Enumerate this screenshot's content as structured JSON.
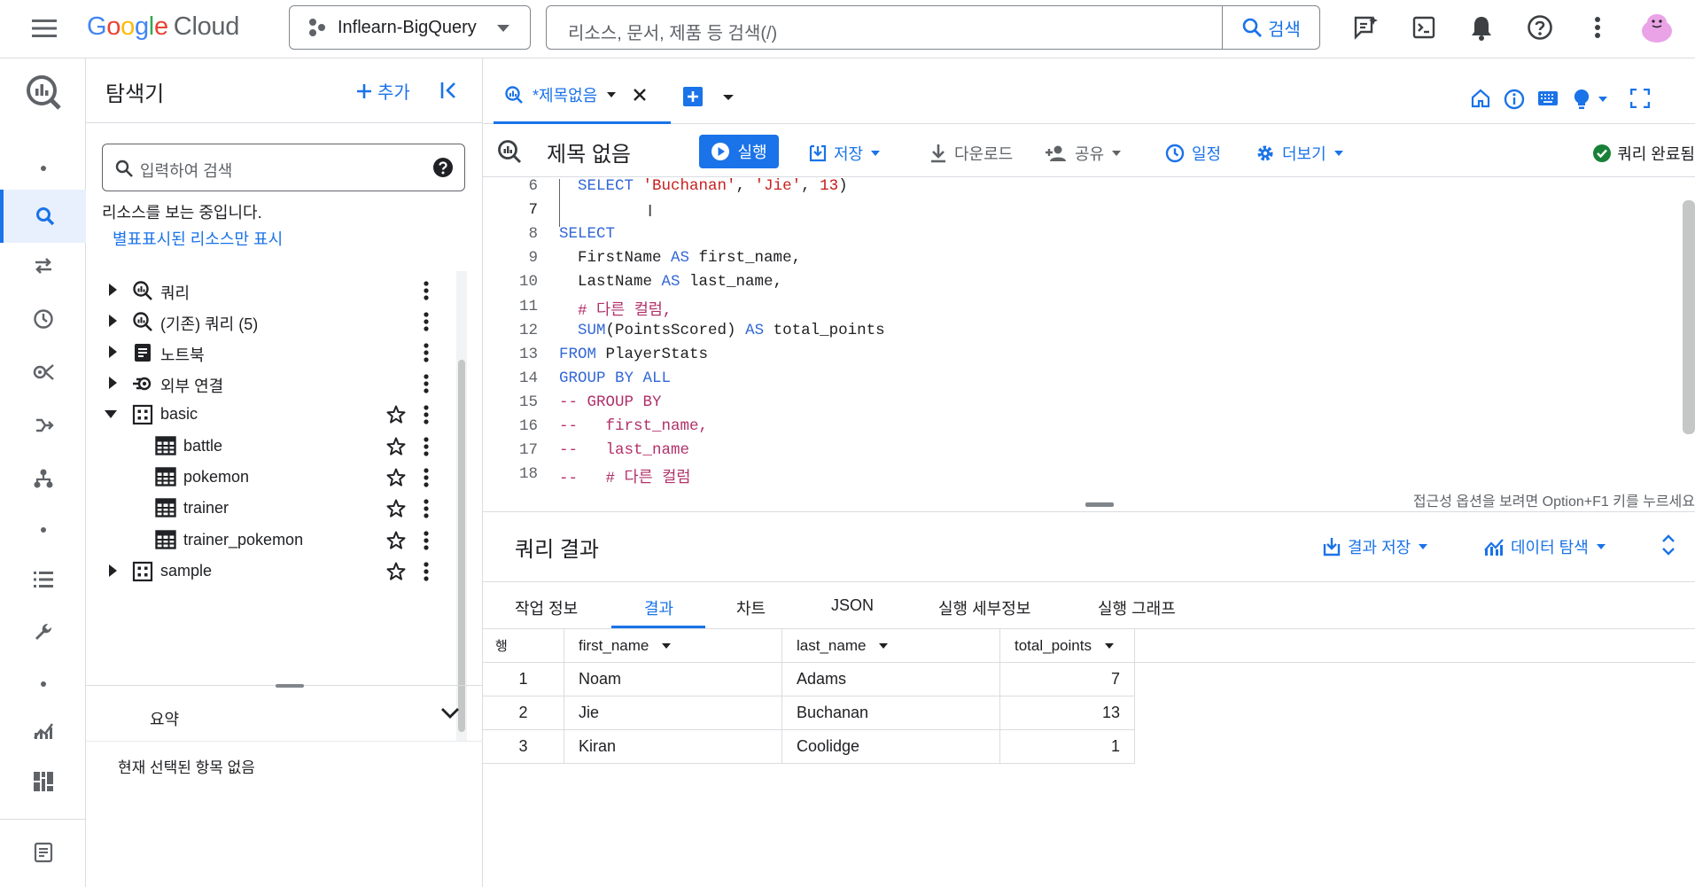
{
  "topbar": {
    "logo": {
      "google": [
        "G",
        "o",
        "o",
        "g",
        "l",
        "e"
      ],
      "cloud": "Cloud"
    },
    "project": "Inflearn-BigQuery",
    "search_placeholder": "리소스, 문서, 제품 등 검색(/)",
    "search_button": "검색"
  },
  "explorer": {
    "title": "탐색기",
    "add_label": "추가",
    "search_placeholder": "입력하여 검색",
    "note": "리소스를 보는 중입니다.",
    "starred_link": "별표표시된 리소스만 표시",
    "tree": [
      {
        "label": "쿼리",
        "icon": "query-icon",
        "level": 0,
        "expander": "collapsed",
        "star": false
      },
      {
        "label": "(기존) 쿼리 (5)",
        "icon": "query-icon",
        "level": 0,
        "expander": "collapsed",
        "star": false
      },
      {
        "label": "노트북",
        "icon": "notebook-icon",
        "level": 0,
        "expander": "collapsed",
        "star": false
      },
      {
        "label": "외부 연결",
        "icon": "connection-icon",
        "level": 0,
        "expander": "collapsed",
        "star": false
      },
      {
        "label": "basic",
        "icon": "dataset-icon",
        "level": 0,
        "expander": "expanded",
        "star": true
      },
      {
        "label": "battle",
        "icon": "table-icon",
        "level": 1,
        "expander": "none",
        "star": true
      },
      {
        "label": "pokemon",
        "icon": "table-icon",
        "level": 1,
        "expander": "none",
        "star": true
      },
      {
        "label": "trainer",
        "icon": "table-icon",
        "level": 1,
        "expander": "none",
        "star": true
      },
      {
        "label": "trainer_pokemon",
        "icon": "table-icon",
        "level": 1,
        "expander": "none",
        "star": true
      },
      {
        "label": "sample",
        "icon": "dataset-icon",
        "level": 0,
        "expander": "collapsed",
        "star": true
      }
    ],
    "summary_title": "요약",
    "summary_empty": "현재 선택된 항목 없음"
  },
  "editor": {
    "tab_label": "*제목없음",
    "title": "제목 없음",
    "run": "실행",
    "save": "저장",
    "download": "다운로드",
    "share": "공유",
    "schedule": "일정",
    "more": "더보기",
    "status": "쿼리 완료됨",
    "accessibility_hint": "접근성 옵션을 보려면 Option+F1 키를 누르세요",
    "lines": [
      {
        "n": "6",
        "tokens": [
          [
            "",
            "  "
          ],
          [
            "k",
            "SELECT"
          ],
          [
            "",
            " "
          ],
          [
            "str",
            "'Buchanan'"
          ],
          [
            "",
            ", "
          ],
          [
            "str",
            "'Jie'"
          ],
          [
            "",
            ", "
          ],
          [
            "n",
            "13"
          ],
          [
            "",
            ")"
          ]
        ]
      },
      {
        "n": "7",
        "tokens": []
      },
      {
        "n": "8",
        "tokens": [
          [
            "k",
            "SELECT"
          ]
        ]
      },
      {
        "n": "9",
        "tokens": [
          [
            "",
            "  FirstName "
          ],
          [
            "k",
            "AS"
          ],
          [
            "",
            " first_name,"
          ]
        ]
      },
      {
        "n": "10",
        "tokens": [
          [
            "",
            "  LastName "
          ],
          [
            "k",
            "AS"
          ],
          [
            "",
            " last_name,"
          ]
        ]
      },
      {
        "n": "11",
        "tokens": [
          [
            "c",
            "  # 다른 컬럼,"
          ]
        ]
      },
      {
        "n": "12",
        "tokens": [
          [
            "",
            "  "
          ],
          [
            "f",
            "SUM"
          ],
          [
            "",
            "(PointsScored) "
          ],
          [
            "k",
            "AS"
          ],
          [
            "",
            " total_points"
          ]
        ]
      },
      {
        "n": "13",
        "tokens": [
          [
            "k",
            "FROM"
          ],
          [
            "",
            " PlayerStats"
          ]
        ]
      },
      {
        "n": "14",
        "tokens": [
          [
            "k",
            "GROUP BY ALL"
          ]
        ]
      },
      {
        "n": "15",
        "tokens": [
          [
            "c",
            "-- GROUP BY"
          ]
        ]
      },
      {
        "n": "16",
        "tokens": [
          [
            "c",
            "--   first_name,"
          ]
        ]
      },
      {
        "n": "17",
        "tokens": [
          [
            "c",
            "--   last_name"
          ]
        ]
      },
      {
        "n": "18",
        "tokens": [
          [
            "c",
            "--   # 다른 컬럼"
          ]
        ]
      }
    ]
  },
  "results": {
    "title": "쿼리 결과",
    "save_results": "결과 저장",
    "explore_data": "데이터 탐색",
    "tabs": [
      "작업 정보",
      "결과",
      "차트",
      "JSON",
      "실행 세부정보",
      "실행 그래프"
    ],
    "active_tab": "결과",
    "columns": [
      "행",
      "first_name",
      "last_name",
      "total_points"
    ],
    "rows": [
      [
        "1",
        "Noam",
        "Adams",
        "7"
      ],
      [
        "2",
        "Jie",
        "Buchanan",
        "13"
      ],
      [
        "3",
        "Kiran",
        "Coolidge",
        "1"
      ]
    ]
  },
  "colors": {
    "accent": "#1a73e8",
    "success": "#188038"
  }
}
